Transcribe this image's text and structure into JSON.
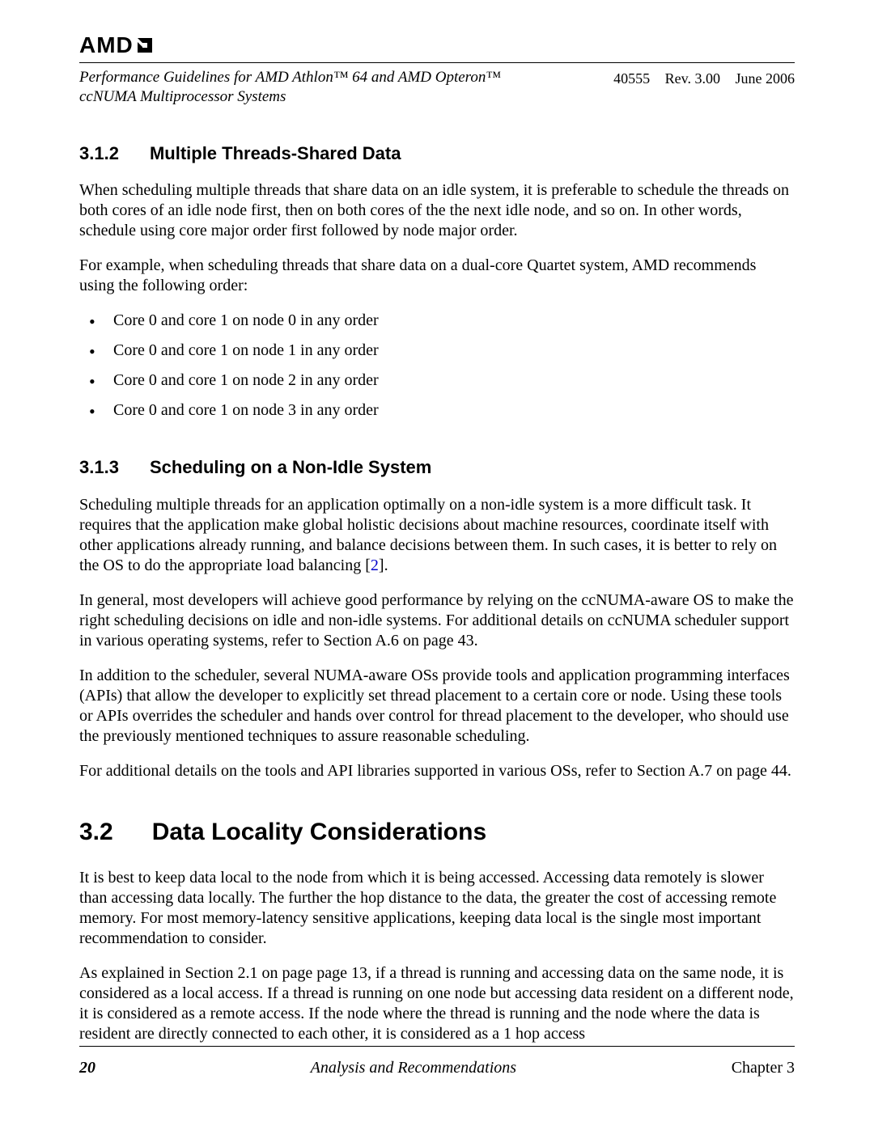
{
  "logo_text": "AMD",
  "header": {
    "title_line1": "Performance Guidelines for AMD Athlon™ 64 and AMD Opteron™",
    "title_line2": "ccNUMA Multiprocessor Systems",
    "doc_id": "40555",
    "rev": "Rev. 3.00",
    "date": "June 2006"
  },
  "s312": {
    "num": "3.1.2",
    "title": "Multiple Threads-Shared Data",
    "p1": "When scheduling multiple threads that share data on an idle system, it is preferable to schedule the threads on both cores of an idle node first, then on both cores of the the next idle node, and so on. In other words, schedule using core major order first followed by node major order.",
    "p2": "For example, when scheduling threads that share data on a dual-core Quartet system, AMD recommends using the following order:",
    "bullets": [
      "Core 0 and core 1 on node 0 in any order",
      "Core 0 and core 1 on node 1 in any order",
      "Core 0 and core 1 on node 2 in any order",
      "Core 0 and core 1 on node 3 in any order"
    ]
  },
  "s313": {
    "num": "3.1.3",
    "title": "Scheduling on a Non-Idle System",
    "p1a": "Scheduling multiple threads for an application optimally on a non-idle system is a more difficult task. It requires that the application make global holistic decisions about machine resources, coordinate itself with other applications already running, and balance decisions between them. In such cases, it is better to rely on the OS to do the appropriate load balancing [",
    "ref": "2",
    "p1b": "].",
    "p2": "In general, most developers will achieve good performance by relying on the ccNUMA-aware OS to make the right scheduling decisions on idle and non-idle systems. For additional details on ccNUMA scheduler support in various operating systems, refer to Section A.6 on page 43.",
    "p3": "In addition to the scheduler, several NUMA-aware OSs provide tools and application programming interfaces (APIs) that allow the developer to explicitly set thread placement to a certain core or node. Using these tools or APIs overrides the scheduler and hands over control for thread placement to the developer, who should use the previously mentioned techniques to assure reasonable scheduling.",
    "p4": "For additional details on the tools and API libraries supported in various OSs, refer to Section A.7 on page 44."
  },
  "s32": {
    "num": "3.2",
    "title": "Data Locality Considerations",
    "p1": "It is best to keep data local to the node from which it is being accessed. Accessing data remotely is slower than accessing data locally. The further the hop distance to the data, the greater the cost of accessing remote memory. For most memory-latency sensitive applications, keeping data local is the single most important recommendation to consider.",
    "p2": "As explained in Section 2.1 on page page 13, if a thread is running and accessing data on the same node, it is considered as a local access. If a thread is running on one node but accessing data resident on a different node, it is considered as a remote access. If the node where the thread is running and the node where the data is resident are directly connected to each other, it is considered as a 1 hop access"
  },
  "footer": {
    "page": "20",
    "center": "Analysis and Recommendations",
    "right": "Chapter 3"
  }
}
